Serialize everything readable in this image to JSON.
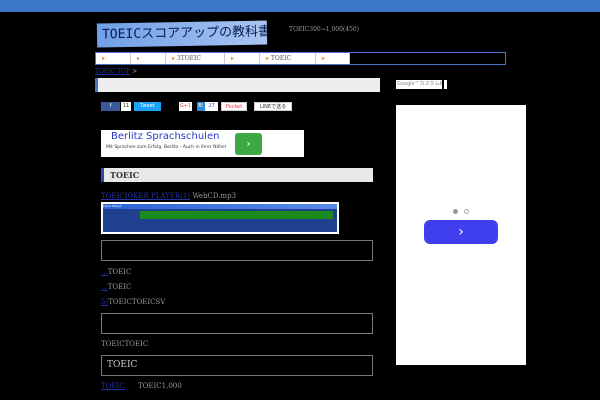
{
  "header": {
    "logo_text": "TOEICスコアアップの教科書",
    "tagline": "TOEIC300→1,000(450)"
  },
  "nav": [
    "",
    "",
    "3TOEIC",
    "",
    "TOEIC",
    ""
  ],
  "breadcrumb": {
    "home": "TOEIC TOP",
    "sep": ">"
  },
  "search": {
    "placeholder": "Google™カスタム検索"
  },
  "social": {
    "facebook": "f",
    "facebook_count": "11",
    "tweet": "Tweet",
    "gplus": "G+1",
    "hatena": "B!",
    "hatena_count": "27",
    "pocket": "Pocket",
    "line": "LINEで送る"
  },
  "ad_top": {
    "title": "Berlitz Sprachschulen",
    "desc": "Mit Sprachen zum Erfolg. Berlitz - Auch in Ihrer Nähe!",
    "button": "›"
  },
  "section": {
    "heading": "TOEIC"
  },
  "content": {
    "link1": "TOEICJOKER PLAYER(1)",
    "link1_rest": "WebCD.mp3",
    "player_title": "Joker Player",
    "item1_link": "...",
    "item1": "TOEIC",
    "item2_link": "...",
    "item2": "TOEIC",
    "item3_link": "5)",
    "item3": "TOEICTOEICSV",
    "para": "TOEICTOEIC",
    "box_heading": "TOEIC",
    "link2": "TOEIC",
    "link2_rest": "TOEIC1,000"
  },
  "ad_side": {
    "button": "›"
  }
}
